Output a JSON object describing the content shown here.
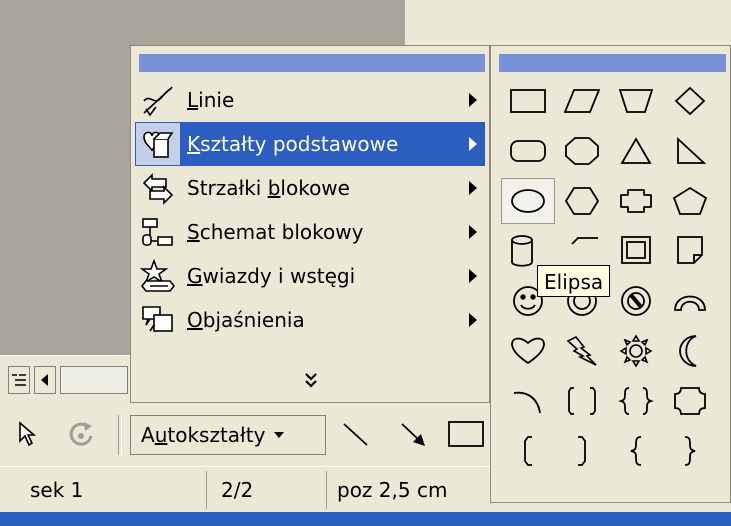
{
  "menu": {
    "items": [
      {
        "label_pre": "",
        "label_key": "L",
        "label_post": "inie",
        "icon": "lines-icon"
      },
      {
        "label_pre": "",
        "label_key": "K",
        "label_post": "ształty podstawowe",
        "icon": "basic-shapes-icon",
        "active": true
      },
      {
        "label_pre": "Strzałki ",
        "label_key": "b",
        "label_post": "lokowe",
        "icon": "block-arrows-icon"
      },
      {
        "label_pre": "",
        "label_key": "S",
        "label_post": "chemat blokowy",
        "icon": "flowchart-icon"
      },
      {
        "label_pre": "",
        "label_key": "G",
        "label_post": "wiazdy i wstęgi",
        "icon": "stars-banners-icon"
      },
      {
        "label_pre": "",
        "label_key": "O",
        "label_post": "bjaśnienia",
        "icon": "callouts-icon"
      }
    ],
    "expand_icon": "double-chevron-down-icon"
  },
  "palette": {
    "tooltip": "Elipsa",
    "selected": "ellipse"
  },
  "toolbar": {
    "autoshapes_pre": "A",
    "autoshapes_key": "u",
    "autoshapes_post": "tokształty"
  },
  "status": {
    "section": "sek 1",
    "pages": "2/2",
    "position": "poz 2,5 cm"
  },
  "colors": {
    "highlight": "#2c5ec2",
    "caption": "#7790d6",
    "face": "#ebe8d6"
  }
}
